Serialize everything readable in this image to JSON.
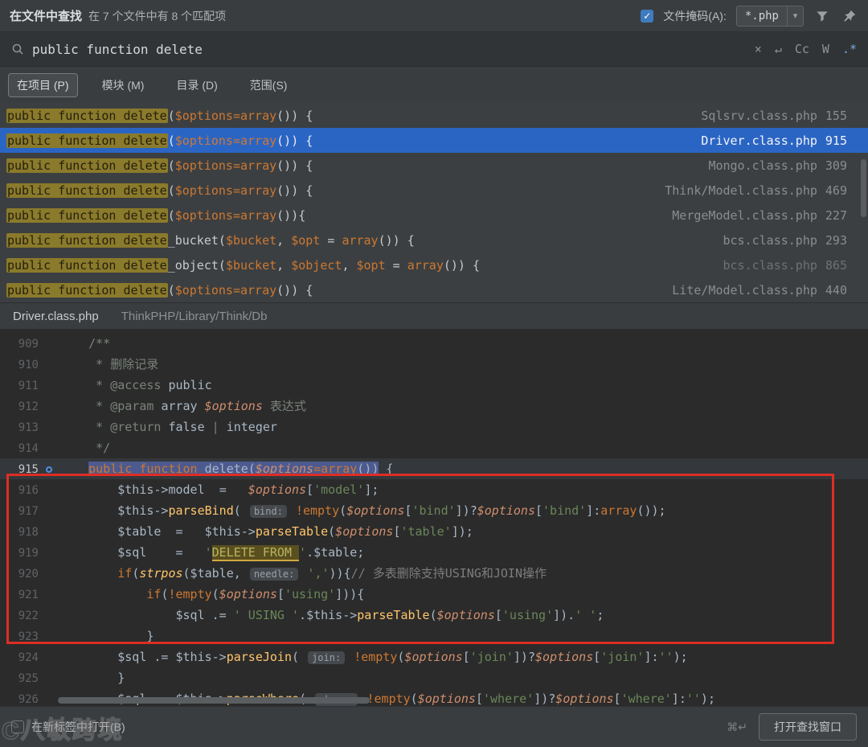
{
  "titlebar": {
    "title": "在文件中查找",
    "summary": "在 7 个文件中有 8 个匹配项",
    "mask_label": "文件掩码(A):",
    "mask_value": "*.php"
  },
  "search": {
    "query": "public function delete",
    "icons": {
      "clear": "×",
      "newline": "↵",
      "case": "Cc",
      "words": "W",
      "regex": ".*"
    }
  },
  "scopes": [
    {
      "label": "在项目 (P)",
      "active": true
    },
    {
      "label": "模块 (M)",
      "active": false
    },
    {
      "label": "目录 (D)",
      "active": false
    },
    {
      "label": "范围(S)",
      "active": false
    }
  ],
  "results": [
    {
      "match": "public function delete",
      "rest": [
        [
          "v",
          "("
        ],
        [
          "p",
          "$options"
        ],
        [
          "k",
          "=array"
        ],
        [
          "v",
          "()) {"
        ]
      ],
      "file": "Sqlsrv.class.php",
      "line": "155",
      "selected": false,
      "dim": false
    },
    {
      "match": "public function delete",
      "rest": [
        [
          "v",
          "("
        ],
        [
          "p",
          "$options"
        ],
        [
          "k",
          "=array"
        ],
        [
          "v",
          "()) {"
        ]
      ],
      "file": "Driver.class.php",
      "line": "915",
      "selected": true,
      "dim": false
    },
    {
      "match": "public function delete",
      "rest": [
        [
          "v",
          "("
        ],
        [
          "p",
          "$options"
        ],
        [
          "k",
          "=array"
        ],
        [
          "v",
          "()) {"
        ]
      ],
      "file": "Mongo.class.php",
      "line": "309",
      "selected": false,
      "dim": false
    },
    {
      "match": "public function delete",
      "rest": [
        [
          "v",
          "("
        ],
        [
          "p",
          "$options"
        ],
        [
          "k",
          "=array"
        ],
        [
          "v",
          "()) {"
        ]
      ],
      "file": "Think/Model.class.php",
      "line": "469",
      "selected": false,
      "dim": false
    },
    {
      "match": "public function delete",
      "rest": [
        [
          "v",
          "("
        ],
        [
          "p",
          "$options"
        ],
        [
          "k",
          "=array"
        ],
        [
          "v",
          "()){"
        ]
      ],
      "file": "MergeModel.class.php",
      "line": "227",
      "selected": false,
      "dim": false
    },
    {
      "match": "public function delete",
      "rest": [
        [
          "v",
          "_bucket("
        ],
        [
          "p",
          "$bucket"
        ],
        [
          "v",
          ", "
        ],
        [
          "p",
          "$opt"
        ],
        [
          "v",
          " = "
        ],
        [
          "k",
          "array"
        ],
        [
          "v",
          "()) {"
        ]
      ],
      "file": "bcs.class.php",
      "line": "293",
      "selected": false,
      "dim": false
    },
    {
      "match": "public function delete",
      "rest": [
        [
          "v",
          "_object("
        ],
        [
          "p",
          "$bucket"
        ],
        [
          "v",
          ", "
        ],
        [
          "p",
          "$object"
        ],
        [
          "v",
          ", "
        ],
        [
          "p",
          "$opt"
        ],
        [
          "v",
          " = "
        ],
        [
          "k",
          "array"
        ],
        [
          "v",
          "()) {"
        ]
      ],
      "file": "bcs.class.php",
      "line": "865",
      "selected": false,
      "dim": true
    },
    {
      "match": "public function delete",
      "rest": [
        [
          "v",
          "("
        ],
        [
          "p",
          "$options"
        ],
        [
          "k",
          "=array"
        ],
        [
          "v",
          "()) {"
        ]
      ],
      "file": "Lite/Model.class.php",
      "line": "440",
      "selected": false,
      "dim": false
    }
  ],
  "preview": {
    "file": "Driver.class.php",
    "path": "ThinkPHP/Library/Think/Db"
  },
  "code": {
    "lines": [
      {
        "no": "909",
        "seg": [
          [
            "d",
            "    /**"
          ]
        ]
      },
      {
        "no": "910",
        "seg": [
          [
            "d",
            "     * 删除记录"
          ]
        ]
      },
      {
        "no": "911",
        "seg": [
          [
            "d",
            "     * @access "
          ],
          [
            "dv",
            "public"
          ]
        ]
      },
      {
        "no": "912",
        "seg": [
          [
            "d",
            "     * @param "
          ],
          [
            "dv",
            "array "
          ],
          [
            "p",
            "$options"
          ],
          [
            "d",
            " 表达式"
          ]
        ]
      },
      {
        "no": "913",
        "seg": [
          [
            "d",
            "     * @return "
          ],
          [
            "dv",
            "false "
          ],
          [
            "d",
            "| "
          ],
          [
            "dv",
            "integer"
          ]
        ]
      },
      {
        "no": "914",
        "seg": [
          [
            "d",
            "     */"
          ]
        ]
      },
      {
        "no": "915",
        "cur": true,
        "seg": [
          [
            "v",
            "    "
          ],
          [
            "k hl",
            "public function"
          ],
          [
            "v hl",
            " delete("
          ],
          [
            "p hl",
            "$options"
          ],
          [
            "k hl",
            "=array"
          ],
          [
            "v hl",
            "())"
          ],
          [
            "v",
            " {"
          ]
        ]
      },
      {
        "no": "916",
        "seg": [
          [
            "v",
            "        $this"
          ],
          [
            "o",
            "->"
          ],
          [
            "v",
            "model  "
          ],
          [
            "o",
            "=   "
          ],
          [
            "p",
            "$options"
          ],
          [
            "v",
            "["
          ],
          [
            "s",
            "'model'"
          ],
          [
            "v",
            "];"
          ]
        ]
      },
      {
        "no": "917",
        "seg": [
          [
            "v",
            "        $this"
          ],
          [
            "o",
            "->"
          ],
          [
            "f",
            "parseBind"
          ],
          [
            "v",
            "( "
          ],
          [
            "h",
            "bind:"
          ],
          [
            "v",
            " "
          ],
          [
            "k",
            "!empty"
          ],
          [
            "v",
            "("
          ],
          [
            "p",
            "$options"
          ],
          [
            "v",
            "["
          ],
          [
            "s",
            "'bind'"
          ],
          [
            "v",
            "])?"
          ],
          [
            "p",
            "$options"
          ],
          [
            "v",
            "["
          ],
          [
            "s",
            "'bind'"
          ],
          [
            "v",
            "]:"
          ],
          [
            "k",
            "array"
          ],
          [
            "v",
            "());"
          ]
        ]
      },
      {
        "no": "918",
        "seg": [
          [
            "v",
            "        $table  "
          ],
          [
            "o",
            "=   "
          ],
          [
            "v",
            "$this"
          ],
          [
            "o",
            "->"
          ],
          [
            "f",
            "parseTable"
          ],
          [
            "v",
            "("
          ],
          [
            "p",
            "$options"
          ],
          [
            "v",
            "["
          ],
          [
            "s",
            "'table'"
          ],
          [
            "v",
            "]);"
          ]
        ]
      },
      {
        "no": "919",
        "seg": [
          [
            "v",
            "        $sql    "
          ],
          [
            "o",
            "=   "
          ],
          [
            "s",
            "'"
          ],
          [
            "sq",
            "DELETE FROM "
          ],
          [
            "s",
            "'"
          ],
          [
            "v",
            "."
          ],
          [
            "v",
            "$table;"
          ]
        ]
      },
      {
        "no": "920",
        "seg": [
          [
            "k",
            "        if"
          ],
          [
            "v",
            "("
          ],
          [
            "fi",
            "strpos"
          ],
          [
            "v",
            "($table, "
          ],
          [
            "h",
            "needle:"
          ],
          [
            "v",
            " "
          ],
          [
            "s",
            "','"
          ],
          [
            "v",
            ")){"
          ],
          [
            "c",
            "// 多表删除支持USING和JOIN操作"
          ]
        ]
      },
      {
        "no": "921",
        "seg": [
          [
            "k",
            "            if"
          ],
          [
            "v",
            "("
          ],
          [
            "k",
            "!empty"
          ],
          [
            "v",
            "("
          ],
          [
            "p",
            "$options"
          ],
          [
            "v",
            "["
          ],
          [
            "s",
            "'using'"
          ],
          [
            "v",
            "])){"
          ]
        ]
      },
      {
        "no": "922",
        "seg": [
          [
            "v",
            "                $sql "
          ],
          [
            "o",
            ".= "
          ],
          [
            "s",
            "' USING '"
          ],
          [
            "v",
            "."
          ],
          [
            "v",
            "$this"
          ],
          [
            "o",
            "->"
          ],
          [
            "f",
            "parseTable"
          ],
          [
            "v",
            "("
          ],
          [
            "p",
            "$options"
          ],
          [
            "v",
            "["
          ],
          [
            "s",
            "'using'"
          ],
          [
            "v",
            "])."
          ],
          [
            "s",
            "' '"
          ],
          [
            "v",
            ";"
          ]
        ]
      },
      {
        "no": "923",
        "seg": [
          [
            "v",
            "            }"
          ]
        ]
      },
      {
        "no": "924",
        "seg": [
          [
            "v",
            "        $sql "
          ],
          [
            "o",
            ".= "
          ],
          [
            "v",
            "$this"
          ],
          [
            "o",
            "->"
          ],
          [
            "f",
            "parseJoin"
          ],
          [
            "v",
            "( "
          ],
          [
            "h",
            "join:"
          ],
          [
            "v",
            " "
          ],
          [
            "k",
            "!empty"
          ],
          [
            "v",
            "("
          ],
          [
            "p",
            "$options"
          ],
          [
            "v",
            "["
          ],
          [
            "s",
            "'join'"
          ],
          [
            "v",
            "])?"
          ],
          [
            "p",
            "$options"
          ],
          [
            "v",
            "["
          ],
          [
            "s",
            "'join'"
          ],
          [
            "v",
            "]:"
          ],
          [
            "s",
            "''"
          ],
          [
            "v",
            ");"
          ]
        ]
      },
      {
        "no": "925",
        "seg": [
          [
            "v",
            "        }"
          ]
        ]
      },
      {
        "no": "926",
        "seg": [
          [
            "v",
            "        $sql "
          ],
          [
            "o",
            ".= "
          ],
          [
            "v",
            "$this"
          ],
          [
            "o",
            "->"
          ],
          [
            "f",
            "parseWhere"
          ],
          [
            "v",
            "( "
          ],
          [
            "h",
            "where:"
          ],
          [
            "v",
            " "
          ],
          [
            "k",
            "!empty"
          ],
          [
            "v",
            "("
          ],
          [
            "p",
            "$options"
          ],
          [
            "v",
            "["
          ],
          [
            "s",
            "'where'"
          ],
          [
            "v",
            "])?"
          ],
          [
            "p",
            "$options"
          ],
          [
            "v",
            "["
          ],
          [
            "s",
            "'where'"
          ],
          [
            "v",
            "]:"
          ],
          [
            "s",
            "''"
          ],
          [
            "v",
            ");"
          ]
        ]
      }
    ]
  },
  "bottom": {
    "newtab_label": "在新标签中打开(B)",
    "shortcut": "⌘↵",
    "open_button": "打开查找窗口"
  },
  "watermark": {
    "mark": "C",
    "text": "八敏跨境"
  }
}
